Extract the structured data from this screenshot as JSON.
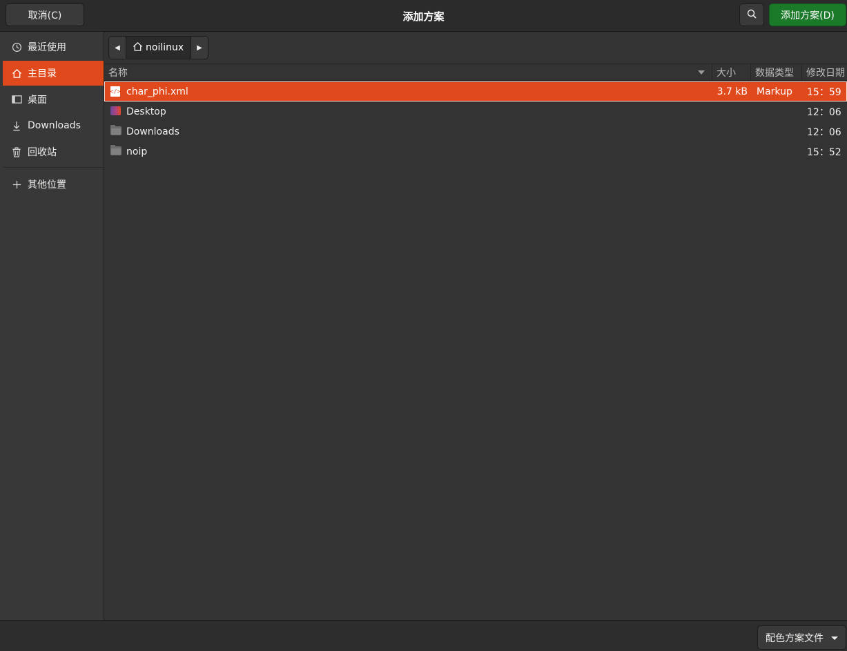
{
  "header": {
    "title": "添加方案",
    "cancel_label": "取消(C)",
    "add_label": "添加方案(D)",
    "search_icon": "search-icon"
  },
  "sidebar": {
    "items": [
      {
        "label": "最近使用",
        "icon": "clock-icon",
        "active": false
      },
      {
        "label": "主目录",
        "icon": "home-icon",
        "active": true
      },
      {
        "label": "桌面",
        "icon": "desktop-icon",
        "active": false
      },
      {
        "label": "Downloads",
        "icon": "download-icon",
        "active": false
      },
      {
        "label": "回收站",
        "icon": "trash-icon",
        "active": false
      },
      {
        "label": "其他位置",
        "icon": "plus-icon",
        "active": false
      }
    ]
  },
  "pathbar": {
    "current": "noilinux"
  },
  "columns": {
    "name": "名称",
    "size": "大小",
    "type": "数据类型",
    "modified": "修改日期"
  },
  "files": [
    {
      "name": "char_phi.xml",
      "size": "3.7 kB",
      "type": "Markup",
      "modified": "15：59",
      "icon": "xml-file-icon",
      "selected": true
    },
    {
      "name": "Desktop",
      "size": "",
      "type": "",
      "modified": "12：06",
      "icon": "desktop-folder-icon",
      "selected": false
    },
    {
      "name": "Downloads",
      "size": "",
      "type": "",
      "modified": "12：06",
      "icon": "folder-icon",
      "selected": false
    },
    {
      "name": "noip",
      "size": "",
      "type": "",
      "modified": "15：52",
      "icon": "folder-icon",
      "selected": false
    }
  ],
  "filter": {
    "label": "配色方案文件"
  },
  "colors": {
    "accent": "#e0491c",
    "suggested_action": "#1a7a29"
  }
}
